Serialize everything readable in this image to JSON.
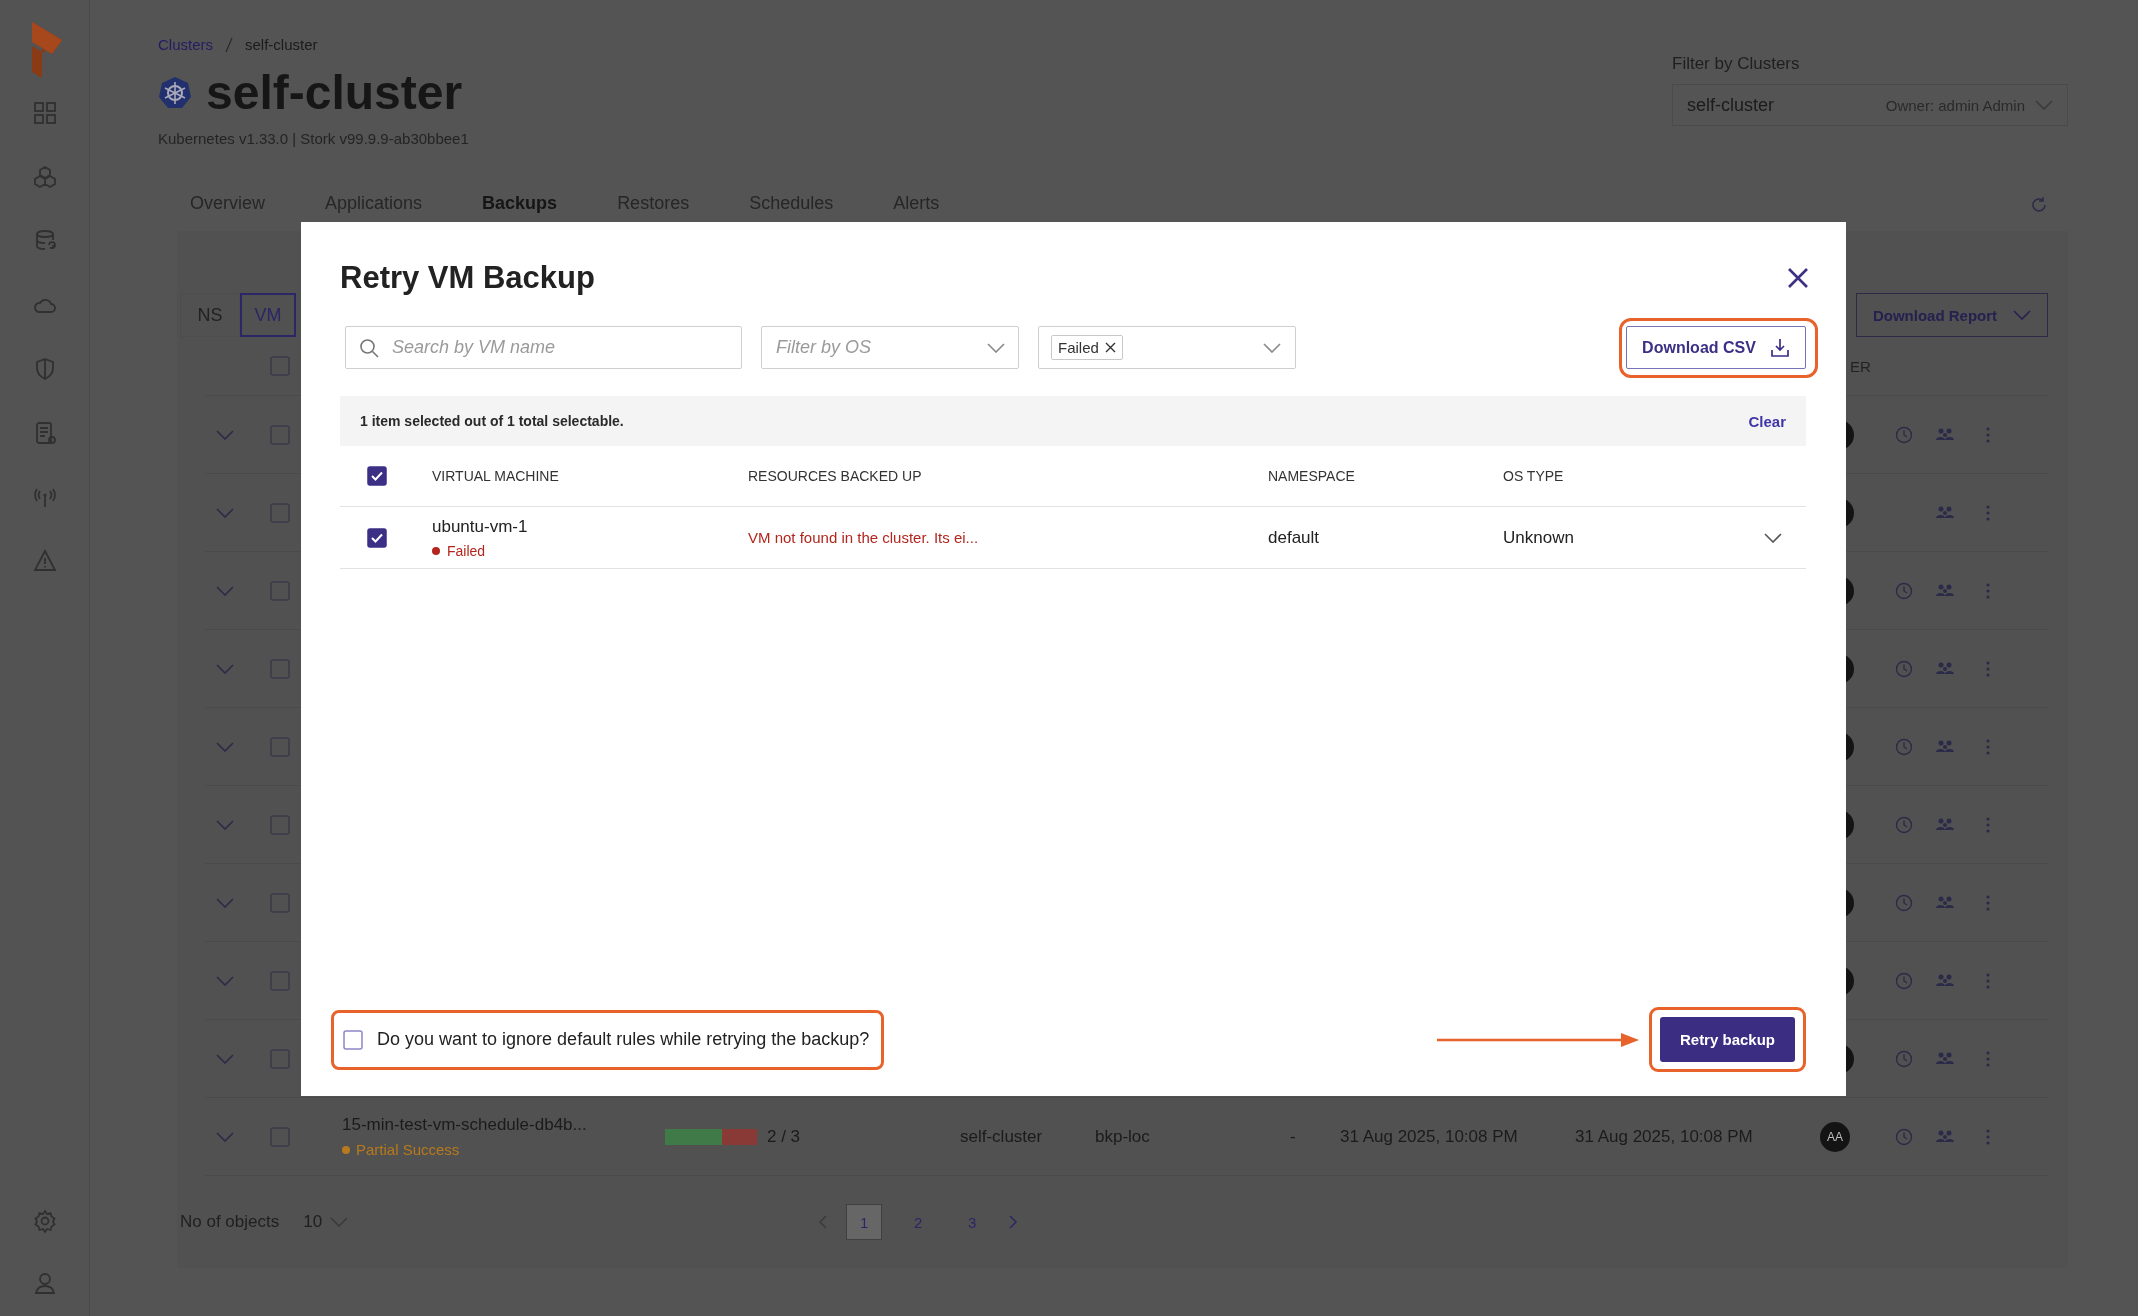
{
  "header": {
    "breadcrumb": [
      "Clusters",
      "self-cluster"
    ],
    "title": "self-cluster",
    "subtitle": "Kubernetes v1.33.0 | Stork v99.9.9-ab30bbee1",
    "cluster_filter": {
      "label": "Filter by Clusters",
      "value": "self-cluster",
      "owner": "Owner: admin Admin"
    },
    "tabs": [
      {
        "label": "Overview",
        "selected": false
      },
      {
        "label": "Applications",
        "selected": false
      },
      {
        "label": "Backups",
        "selected": true
      },
      {
        "label": "Restores",
        "selected": false
      },
      {
        "label": "Schedules",
        "selected": false
      },
      {
        "label": "Alerts",
        "selected": false
      }
    ]
  },
  "backups": {
    "view_toggle": [
      {
        "label": "NS",
        "selected": false
      },
      {
        "label": "VM",
        "selected": true
      }
    ],
    "download_report": "Download Report",
    "select_all_checked": false,
    "column_fragment": "ER",
    "rows": [
      {
        "kind": "covered",
        "checked": false,
        "scheduled": true
      },
      {
        "kind": "covered",
        "checked": false,
        "scheduled": false
      },
      {
        "kind": "covered",
        "checked": false,
        "scheduled": true
      },
      {
        "kind": "covered",
        "checked": false,
        "scheduled": true
      },
      {
        "kind": "covered",
        "checked": false,
        "scheduled": true
      },
      {
        "kind": "covered",
        "checked": false,
        "scheduled": true
      },
      {
        "kind": "covered",
        "checked": false,
        "scheduled": true
      },
      {
        "kind": "covered",
        "checked": false,
        "scheduled": true
      },
      {
        "kind": "covered",
        "checked": false,
        "scheduled": true
      },
      {
        "kind": "full",
        "checked": false,
        "scheduled": true,
        "name": "15-min-test-vm-schedule-db4b...",
        "status": {
          "label": "Partial Success",
          "kind": "partial"
        },
        "level": 0.62,
        "count": "2 / 3",
        "column_4": "self-cluster",
        "column_5": "bkp-loc",
        "column_6": "-",
        "column_7": "31 Aug 2025, 10:08 PM",
        "column_8": "31 Aug 2025, 10:08 PM",
        "column_9": "AA"
      }
    ],
    "pagination": {
      "label": "No of objects",
      "page_size": "10",
      "pages": [
        {
          "label": "1",
          "selected": true
        },
        {
          "label": "2",
          "selected": false
        },
        {
          "label": "3",
          "selected": false
        }
      ]
    }
  },
  "modal": {
    "title": "Retry VM Backup",
    "search": {
      "placeholder": "Search by VM name"
    },
    "os_filter": {
      "placeholder": "Filter by OS"
    },
    "status_filter": {
      "chips": [
        "Failed"
      ]
    },
    "download_csv": "Download CSV",
    "selection_summary": "1 item selected out of 1 total selectable.",
    "clear": "Clear",
    "select_all_checked": true,
    "columns": [
      "VIRTUAL MACHINE",
      "RESOURCES BACKED UP",
      "NAMESPACE",
      "OS TYPE"
    ],
    "rows": [
      {
        "checked": true,
        "name": "ubuntu-vm-1",
        "status": {
          "label": "Failed",
          "kind": "failed"
        },
        "resources": "VM not found in the cluster. Its ei...",
        "namespace": "default",
        "os_type": "Unknown",
        "expanded": false
      }
    ],
    "ignore_rules": {
      "label": "Do you want to ignore default rules while retrying the backup?",
      "checked": false
    },
    "retry_button": "Retry backup"
  }
}
